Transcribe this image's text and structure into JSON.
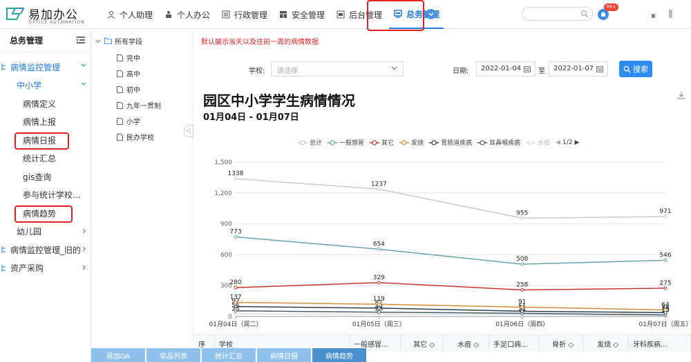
{
  "app": {
    "logo_name": "易加办公",
    "logo_sub": "OFFICE AUTOMATION",
    "badge": "99+"
  },
  "nav": {
    "items": [
      {
        "label": "个人助理"
      },
      {
        "label": "个人办公"
      },
      {
        "label": "行政管理"
      },
      {
        "label": "安全管理"
      },
      {
        "label": "后台管理"
      },
      {
        "label": "总务管理"
      }
    ]
  },
  "sidebar": {
    "title": "总务管理",
    "items": [
      {
        "label": "病情监控管理"
      },
      {
        "label": "中小学"
      },
      {
        "label": "病情定义"
      },
      {
        "label": "病情上报"
      },
      {
        "label": "病情日报"
      },
      {
        "label": "统计汇总"
      },
      {
        "label": "gis查询"
      },
      {
        "label": "参与统计学校..."
      },
      {
        "label": "病情趋势"
      },
      {
        "label": "幼儿园"
      },
      {
        "label": "病情监控管理_旧的"
      },
      {
        "label": "资产采购"
      }
    ]
  },
  "tree": {
    "root": "所有学段",
    "leaves": [
      "完中",
      "高中",
      "初中",
      "九年一贯制",
      "小学",
      "民办学校"
    ]
  },
  "filters": {
    "notice": "默认展示当天以及往前一周的病情数据",
    "school_label": "学校:",
    "school_placeholder": "请选择",
    "date_label": "日期:",
    "date_from": "2022-01-04",
    "to_label": "至",
    "date_to": "2022-01-07",
    "search_label": "搜索"
  },
  "chart_data": {
    "type": "line",
    "title": "园区中小学学生病情情况",
    "subtitle": "01月04日 - 01月07日",
    "categories": [
      "01月04日（周二）",
      "01月05日（周三）",
      "01月06日（周四）",
      "01月07日（周五）"
    ],
    "ylim": [
      0,
      1500
    ],
    "yticks": [
      "0",
      "300",
      "600",
      "900",
      "1,200",
      "1,500"
    ],
    "grid": true,
    "legend_position": "top",
    "legend_page": "1/2",
    "series": [
      {
        "name": "总计",
        "color": "#c9c9c9",
        "values": [
          1338,
          1237,
          955,
          971
        ]
      },
      {
        "name": "一般感冒",
        "color": "#6a9fa8",
        "values": [
          773,
          654,
          508,
          546
        ]
      },
      {
        "name": "其它",
        "color": "#c23531",
        "values": [
          280,
          329,
          258,
          275
        ]
      },
      {
        "name": "发烧",
        "color": "#d48a3a",
        "values": [
          137,
          119,
          91,
          64
        ]
      },
      {
        "name": "胃肠道疾病",
        "color": "#2f3e4a",
        "values": [
          97,
          81,
          51,
          38
        ]
      },
      {
        "name": "耳鼻喉疾病",
        "color": "#4a5c6a",
        "values": [
          55,
          42,
          31,
          16
        ]
      },
      {
        "name": "水痘",
        "color": "#dddddd",
        "values": [
          25,
          23,
          21,
          10
        ]
      }
    ]
  },
  "table": {
    "headers": [
      "序",
      "学校",
      "一般感冒...",
      "其它 ◇",
      "水痘 ◇",
      "手足口病...",
      "骨折 ◇",
      "发烧 ◇",
      "牙科疾病..."
    ]
  },
  "bottom_tabs": [
    {
      "label": "易加OA"
    },
    {
      "label": "菜品列表"
    },
    {
      "label": "统计汇总"
    },
    {
      "label": "病情日报"
    },
    {
      "label": "病情趋势"
    }
  ]
}
